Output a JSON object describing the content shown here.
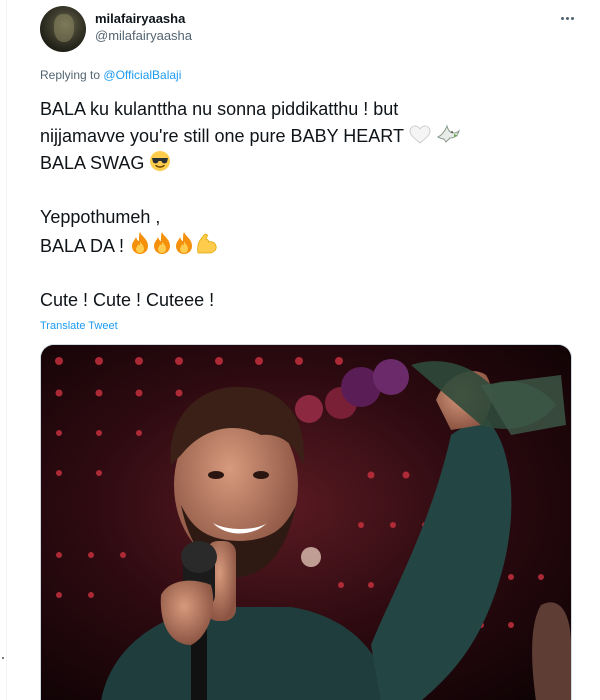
{
  "tweet": {
    "display_name": "milafairyaasha",
    "handle": "@milafairyaasha",
    "replying_prefix": "Replying to",
    "replying_to": "@OfficialBalaji",
    "lines": {
      "l1": "BALA ku kulanttha nu sonna piddikatthu ! but",
      "l2": "nijjamavve you're still one pure BABY HEART",
      "l3": "BALA SWAG",
      "l4": "Yeppothumeh ,",
      "l5": "BALA DA !",
      "l6": "Cute ! Cute ! Cuteee !"
    },
    "emojis": {
      "white_heart": "white-heart-emoji",
      "dove": "dove-emoji",
      "sunglasses": "sunglasses-emoji",
      "fire": "fire-emoji",
      "flexed_biceps": "flexed-biceps-emoji"
    },
    "translate_label": "Translate Tweet",
    "media": {
      "description_icon": "photo",
      "accent": "#b3232f"
    }
  },
  "colors": {
    "link": "#1d9bf0",
    "text": "#0f1419",
    "secondary": "#536471"
  }
}
